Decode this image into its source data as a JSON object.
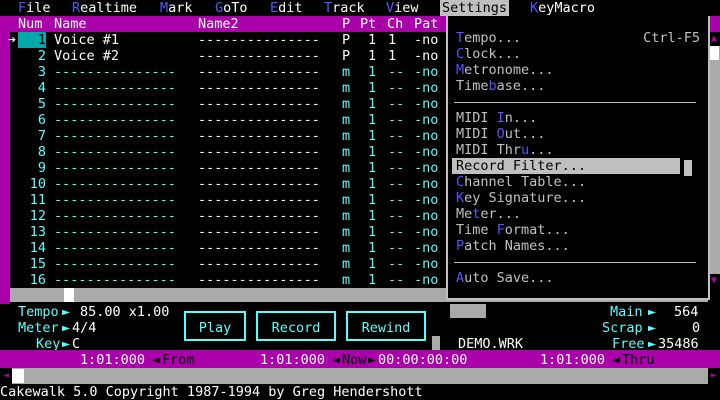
{
  "menu": [
    {
      "hot": "F",
      "rest": "ile"
    },
    {
      "hot": "R",
      "rest": "ealtime"
    },
    {
      "hot": "M",
      "rest": "ark"
    },
    {
      "hot": "G",
      "rest": "oTo"
    },
    {
      "hot": "E",
      "rest": "dit"
    },
    {
      "hot": "T",
      "rest": "rack"
    },
    {
      "hot": "V",
      "rest": "iew"
    },
    {
      "hot": "",
      "rest": "Settings"
    },
    {
      "hot": "K",
      "rest": "eyMacro"
    }
  ],
  "columns": {
    "num": "Num",
    "name": "Name",
    "name2": "Name2",
    "port": "P",
    "pt": "Pt",
    "ch": "Ch",
    "pat": "Pat"
  },
  "tracks": [
    {
      "num": "1",
      "name": "Voice #1",
      "name2": "---------------",
      "p": "P",
      "pt": "1",
      "ch": "1",
      "pat": "-no"
    },
    {
      "num": "2",
      "name": "Voice #2",
      "name2": "---------------",
      "p": "P",
      "pt": "1",
      "ch": "1",
      "pat": "-no"
    },
    {
      "num": "3",
      "name": "---------------",
      "name2": "---------------",
      "p": "m",
      "pt": "1",
      "ch": "--",
      "pat": "-no"
    },
    {
      "num": "4",
      "name": "---------------",
      "name2": "---------------",
      "p": "m",
      "pt": "1",
      "ch": "--",
      "pat": "-no"
    },
    {
      "num": "5",
      "name": "---------------",
      "name2": "---------------",
      "p": "m",
      "pt": "1",
      "ch": "--",
      "pat": "-no"
    },
    {
      "num": "6",
      "name": "---------------",
      "name2": "---------------",
      "p": "m",
      "pt": "1",
      "ch": "--",
      "pat": "-no"
    },
    {
      "num": "7",
      "name": "---------------",
      "name2": "---------------",
      "p": "m",
      "pt": "1",
      "ch": "--",
      "pat": "-no"
    },
    {
      "num": "8",
      "name": "---------------",
      "name2": "---------------",
      "p": "m",
      "pt": "1",
      "ch": "--",
      "pat": "-no"
    },
    {
      "num": "9",
      "name": "---------------",
      "name2": "---------------",
      "p": "m",
      "pt": "1",
      "ch": "--",
      "pat": "-no"
    },
    {
      "num": "10",
      "name": "---------------",
      "name2": "---------------",
      "p": "m",
      "pt": "1",
      "ch": "--",
      "pat": "-no"
    },
    {
      "num": "11",
      "name": "---------------",
      "name2": "---------------",
      "p": "m",
      "pt": "1",
      "ch": "--",
      "pat": "-no"
    },
    {
      "num": "12",
      "name": "---------------",
      "name2": "---------------",
      "p": "m",
      "pt": "1",
      "ch": "--",
      "pat": "-no"
    },
    {
      "num": "13",
      "name": "---------------",
      "name2": "---------------",
      "p": "m",
      "pt": "1",
      "ch": "--",
      "pat": "-no"
    },
    {
      "num": "14",
      "name": "---------------",
      "name2": "---------------",
      "p": "m",
      "pt": "1",
      "ch": "--",
      "pat": "-no"
    },
    {
      "num": "15",
      "name": "---------------",
      "name2": "---------------",
      "p": "m",
      "pt": "1",
      "ch": "--",
      "pat": "-no"
    },
    {
      "num": "16",
      "name": "---------------",
      "name2": "---------------",
      "p": "m",
      "pt": "1",
      "ch": "--",
      "pat": "-no"
    }
  ],
  "settings_menu": [
    {
      "hot": "T",
      "rest": "empo...",
      "shortcut": "Ctrl-F5"
    },
    {
      "hot": "C",
      "rest": "lock...",
      "shortcut": ""
    },
    {
      "hot": "M",
      "rest": "etronome...",
      "shortcut": ""
    },
    {
      "pre": "Time",
      "hot": "b",
      "rest": "ase...",
      "shortcut": ""
    },
    {
      "sep": true
    },
    {
      "pre": "MIDI ",
      "hot": "I",
      "rest": "n...",
      "shortcut": ""
    },
    {
      "pre": "MIDI ",
      "hot": "O",
      "rest": "ut...",
      "shortcut": ""
    },
    {
      "pre": "MIDI Thr",
      "hot": "u",
      "rest": "...",
      "shortcut": ""
    },
    {
      "pre": "",
      "hot": "",
      "rest": "Record Filter...",
      "shortcut": "",
      "highlight": true
    },
    {
      "hot": "C",
      "rest": "hannel Table...",
      "shortcut": ""
    },
    {
      "hot": "K",
      "rest": "ey Signature...",
      "shortcut": ""
    },
    {
      "pre": "Me",
      "hot": "t",
      "rest": "er...",
      "shortcut": ""
    },
    {
      "pre": "Time ",
      "hot": "F",
      "rest": "ormat...",
      "shortcut": ""
    },
    {
      "hot": "P",
      "rest": "atch Names...",
      "shortcut": ""
    },
    {
      "sep": true
    },
    {
      "hot": "A",
      "rest": "uto Save...",
      "shortcut": ""
    }
  ],
  "transport": {
    "tempo_label": "Tempo",
    "tempo_value": "85.00 x1.00",
    "meter_label": "Meter",
    "meter_value": "4/4",
    "key_label": "Key",
    "key_value": "C",
    "play": "Play",
    "record": "Record",
    "rewind": "Rewind",
    "file_name": "DEMO.WRK",
    "main_label": "Main",
    "main_value": "564",
    "scrap_label": "Scrap",
    "scrap_value": "0",
    "free_label": "Free",
    "free_value": "35486"
  },
  "positions": {
    "from_time": "1:01:000",
    "from_label": "From",
    "now_time": "1:01:000",
    "now_label": "Now",
    "now_clock": "00:00:00:00",
    "thru_time": "1:01:000",
    "thru_label": "Thru"
  },
  "status": "Cakewalk 5.0 Copyright 1987-1994 by Greg Hendershott",
  "colors": {
    "frame": "#aa00aa",
    "text": "#55ffff",
    "hotkey": "#5555ff",
    "menu_highlight": "#c0c0c0"
  }
}
